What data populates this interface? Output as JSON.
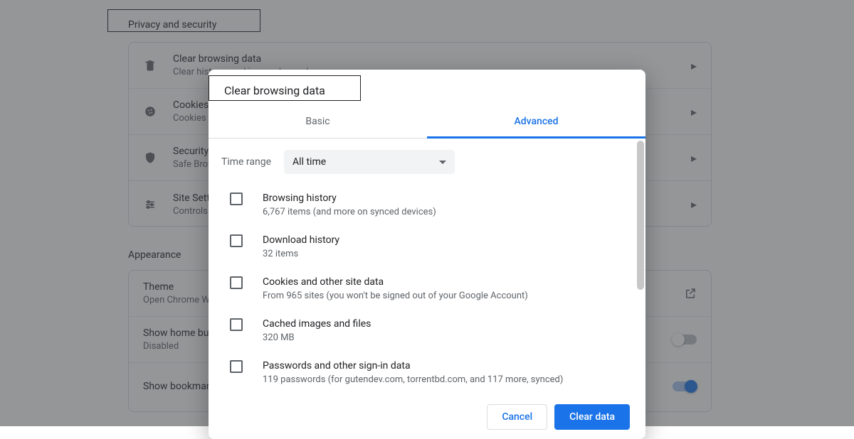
{
  "sections": {
    "privacy_title": "Privacy and security",
    "appearance_title": "Appearance"
  },
  "privacy_rows": [
    {
      "icon": "trash",
      "primary": "Clear browsing data",
      "secondary": "Clear history, cookies, cache, and more"
    },
    {
      "icon": "cookie",
      "primary": "Cookies and other site data",
      "secondary": "Cookies are allowed"
    },
    {
      "icon": "shield",
      "primary": "Security",
      "secondary": "Safe Browsing (protection from dangerous sites) and other security settings"
    },
    {
      "icon": "sliders",
      "primary": "Site Settings",
      "secondary": "Controls what information sites can use and show"
    }
  ],
  "appearance_rows": {
    "theme_primary": "Theme",
    "theme_secondary": "Open Chrome Web Store",
    "home_primary": "Show home button",
    "home_secondary": "Disabled",
    "bookmarks_primary": "Show bookmarks bar"
  },
  "dialog": {
    "title": "Clear browsing data",
    "tabs": {
      "basic": "Basic",
      "advanced": "Advanced"
    },
    "time_label": "Time range",
    "time_value": "All time",
    "options": [
      {
        "primary": "Browsing history",
        "secondary": "6,767 items (and more on synced devices)"
      },
      {
        "primary": "Download history",
        "secondary": "32 items"
      },
      {
        "primary": "Cookies and other site data",
        "secondary": "From 965 sites (you won't be signed out of your Google Account)"
      },
      {
        "primary": "Cached images and files",
        "secondary": "320 MB"
      },
      {
        "primary": "Passwords and other sign-in data",
        "secondary": "119 passwords (for gutendev.com, torrentbd.com, and 117 more, synced)"
      }
    ],
    "cancel": "Cancel",
    "confirm": "Clear data"
  }
}
